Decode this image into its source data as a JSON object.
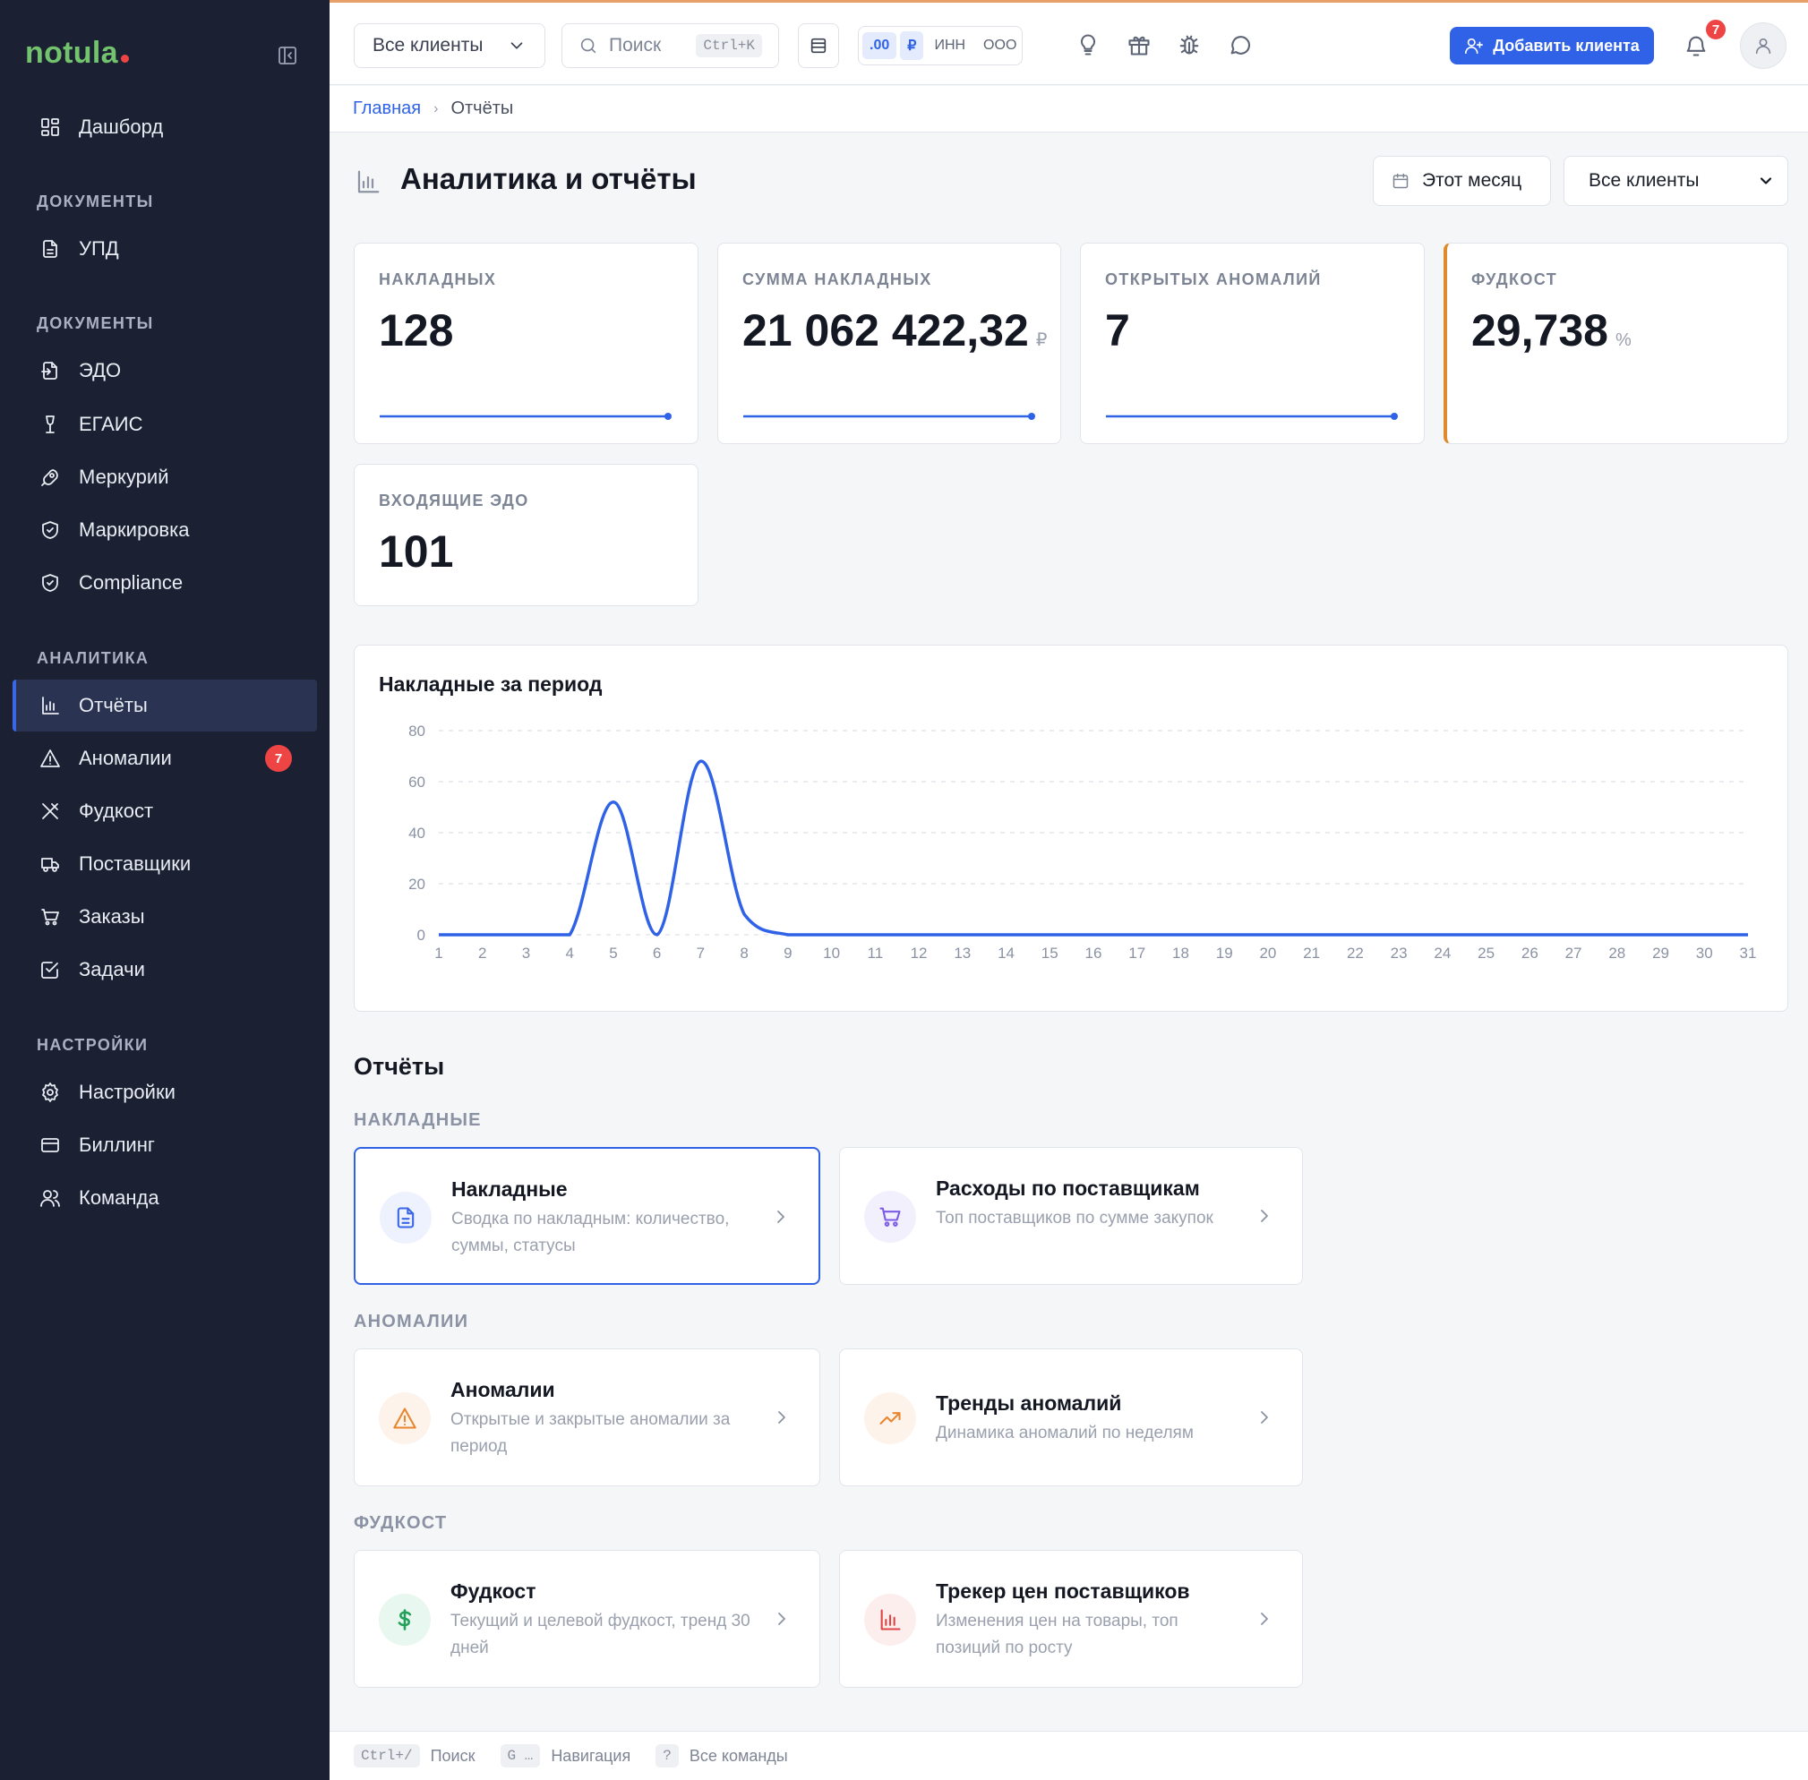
{
  "brand": {
    "name": "notula"
  },
  "sidebar": {
    "items": [
      {
        "label": "Дашборд"
      },
      {
        "section": "ДОКУМЕНТЫ"
      },
      {
        "label": "УПД"
      },
      {
        "section": "ДОКУМЕНТЫ"
      },
      {
        "label": "ЭДО"
      },
      {
        "label": "ЕГАИС"
      },
      {
        "label": "Меркурий"
      },
      {
        "label": "Маркировка"
      },
      {
        "label": "Compliance"
      },
      {
        "section": "АНАЛИТИКА"
      },
      {
        "label": "Отчёты",
        "active": true
      },
      {
        "label": "Аномалии",
        "badge": "7"
      },
      {
        "label": "Фудкост"
      },
      {
        "label": "Поставщики"
      },
      {
        "label": "Заказы"
      },
      {
        "label": "Задачи"
      },
      {
        "section": "НАСТРОЙКИ"
      },
      {
        "label": "Настройки"
      },
      {
        "label": "Биллинг"
      },
      {
        "label": "Команда"
      }
    ]
  },
  "topbar": {
    "client_select": "Все клиенты",
    "search": {
      "placeholder": "Поиск",
      "shortcut": "Ctrl+K"
    },
    "format_toggles": [
      ".00",
      "₽",
      "ИНН",
      "ООО"
    ],
    "add_client": "Добавить клиента",
    "notifications": "7"
  },
  "breadcrumb": {
    "home": "Главная",
    "current": "Отчёты"
  },
  "page": {
    "title": "Аналитика и отчёты",
    "period_button": "Этот месяц",
    "client_filter": "Все клиенты"
  },
  "stats": [
    {
      "label": "НАКЛАДНЫХ",
      "value": "128",
      "unit": ""
    },
    {
      "label": "СУММА НАКЛАДНЫХ",
      "value": "21 062 422,32",
      "unit": "₽"
    },
    {
      "label": "ОТКРЫТЫХ АНОМАЛИЙ",
      "value": "7",
      "unit": ""
    },
    {
      "label": "ФУДКОСТ",
      "value": "29,738",
      "unit": "%"
    },
    {
      "label": "ВХОДЯЩИЕ ЭДО",
      "value": "101",
      "unit": ""
    }
  ],
  "chart_data": {
    "type": "line",
    "title": "Накладные за период",
    "x": [
      1,
      2,
      3,
      4,
      5,
      6,
      7,
      8,
      9,
      10,
      11,
      12,
      13,
      14,
      15,
      16,
      17,
      18,
      19,
      20,
      21,
      22,
      23,
      24,
      25,
      26,
      27,
      28,
      29,
      30,
      31
    ],
    "series": [
      {
        "values": [
          0,
          0,
          0,
          0,
          52,
          0,
          68,
          8,
          0,
          0,
          0,
          0,
          0,
          0,
          0,
          0,
          0,
          0,
          0,
          0,
          0,
          0,
          0,
          0,
          0,
          0,
          0,
          0,
          0,
          0,
          0
        ]
      }
    ],
    "ylim": [
      0,
      80
    ],
    "yticks": [
      0,
      20,
      40,
      60,
      80
    ],
    "grid": true,
    "color": "#2f62e6"
  },
  "reports": {
    "title": "Отчёты",
    "groups": [
      {
        "name": "НАКЛАДНЫЕ",
        "cards": [
          {
            "title": "Накладные",
            "desc": "Сводка по накладным: количество, суммы, статусы",
            "icon": "document-icon",
            "tint": "#eef2fe",
            "color": "#3b67e6"
          },
          {
            "title": "Расходы по поставщикам",
            "desc": "Топ поставщиков по сумме закупок",
            "icon": "cart-icon",
            "tint": "#f3f0fe",
            "color": "#7c5ce6"
          }
        ]
      },
      {
        "name": "АНОМАЛИИ",
        "cards": [
          {
            "title": "Аномалии",
            "desc": "Открытые и закрытые аномалии за период",
            "icon": "warning-icon",
            "tint": "#fef3ea",
            "color": "#e8862f"
          },
          {
            "title": "Тренды аномалий",
            "desc": "Динамика аномалий по неделям",
            "icon": "trend-icon",
            "tint": "#fef3ea",
            "color": "#e8862f"
          }
        ]
      },
      {
        "name": "ФУДКОСТ",
        "cards": [
          {
            "title": "Фудкост",
            "desc": "Текущий и целевой фудкост, тренд 30 дней",
            "icon": "dollar-icon",
            "tint": "#e8f7ef",
            "color": "#22a05a"
          },
          {
            "title": "Трекер цен поставщиков",
            "desc": "Изменения цен на товары, топ позиций по росту",
            "icon": "bar-chart-icon",
            "tint": "#fdeeee",
            "color": "#e04545"
          }
        ]
      }
    ]
  },
  "footer": [
    {
      "key": "Ctrl+/",
      "label": "Поиск"
    },
    {
      "key": "G …",
      "label": "Навигация"
    },
    {
      "key": "?",
      "label": "Все команды"
    }
  ],
  "colors": {
    "accent": "#2f62e6",
    "sidebar_bg": "#1b2133",
    "danger": "#ef4444",
    "foodcost_accent": "#e08a2e"
  }
}
